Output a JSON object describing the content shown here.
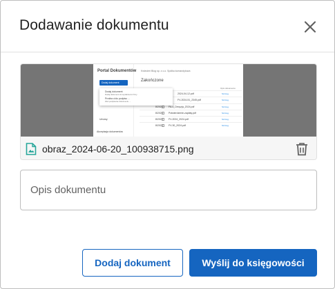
{
  "dialog": {
    "title": "Dodawanie dokumentu",
    "close_icon": "close-icon"
  },
  "attachment": {
    "file_name": "obraz_2024-06-20_100938715.png",
    "file_icon": "image-file-icon",
    "delete_icon": "trash-icon",
    "preview": {
      "app_title": "Portal Dokumentów",
      "breadcrumb": "Kwiecień Blog sp. z o.o. Spółka komandytowa",
      "button_label": "Dodaj dokument",
      "section_title": "Zakończone",
      "menu_items": [
        {
          "title": "Dodaj dokument",
          "subtitle": "Dodaj dokument do wysłania do firmy"
        },
        {
          "title": "Prośba o/do podpisu ...",
          "subtitle": "Zleć podpisanie dokumentu ..."
        }
      ],
      "sidebar_items": [
        "Dokumenty",
        "Zlecenia",
        "Umowy",
        "Akceptacja dokumentów"
      ],
      "column_header": "Opis dokumentu",
      "rows": [
        {
          "date": "",
          "name": "2024-04-12.pdf",
          "link": "Szczeg."
        },
        {
          "date": "",
          "name": "FV-2024-51_2345.pdf",
          "link": "Szczeg."
        },
        {
          "date": "8/2024",
          "name": "FA-6_Decyzja_2024.pdf",
          "link": "Szczeg."
        },
        {
          "date": "8/2024",
          "name": "Potwierdzenie-zapłaty.pdf",
          "link": "Szczeg."
        },
        {
          "date": "8/2024",
          "name": "FV-2024_2024.pdf",
          "link": "Szczeg."
        },
        {
          "date": "8/2024",
          "name": "FV-30_2024.pdf",
          "link": "Szczeg."
        }
      ]
    }
  },
  "description": {
    "placeholder": "Opis dokumentu",
    "value": ""
  },
  "actions": {
    "add_label": "Dodaj dokument",
    "send_label": "Wyślij do księgowości"
  },
  "colors": {
    "primary": "#1565c0",
    "preview_bg": "#757575",
    "file_icon": "#26a69a"
  }
}
